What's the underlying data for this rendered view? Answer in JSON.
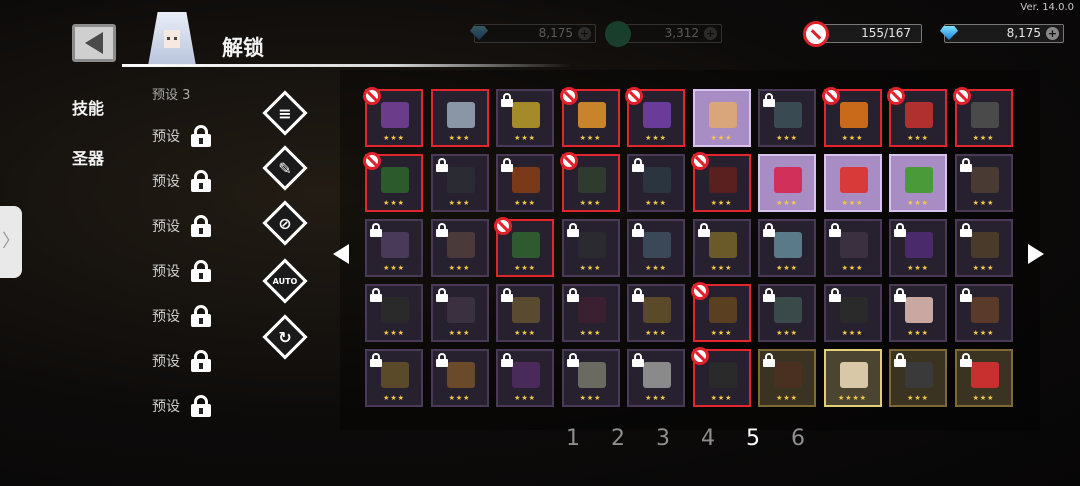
{
  "version": "Ver. 14.0.0",
  "header": {
    "title": "解锁"
  },
  "currency": [
    {
      "name": "dim-gem-currency",
      "value": "8,175",
      "dim": true,
      "icon": "gem-icon"
    },
    {
      "name": "dim-coin-currency",
      "value": "3,312",
      "dim": true,
      "icon": "coin-icon"
    },
    {
      "name": "ban-counter",
      "value": "155/167",
      "dim": false,
      "icon": "ban-icon"
    },
    {
      "name": "gem-currency",
      "value": "8,175",
      "dim": false,
      "icon": "gem-icon"
    }
  ],
  "tabs": {
    "skills": "技能",
    "relics": "圣器"
  },
  "presets": {
    "partial_label": "预设 3",
    "items": [
      "预设",
      "预设",
      "预设",
      "预设",
      "预设",
      "预设",
      "预设"
    ]
  },
  "tools": [
    "filter-search",
    "scroll-edit",
    "ban-toggle",
    "auto-ban",
    "ban-reset"
  ],
  "tool_text": {
    "auto": "AUTO"
  },
  "grid": {
    "rows": [
      [
        {
          "state": "ban",
          "style": "red",
          "stars": "★★★",
          "color": "#6a3c8a"
        },
        {
          "state": "normal",
          "style": "red",
          "stars": "★★★",
          "color": "#8a96a6"
        },
        {
          "state": "lock",
          "style": "",
          "stars": "★★★",
          "color": "#a58a2a"
        },
        {
          "state": "ban",
          "style": "red",
          "stars": "★★★",
          "color": "#c8842a"
        },
        {
          "state": "ban",
          "style": "red",
          "stars": "★★★",
          "color": "#6a3c9a"
        },
        {
          "state": "normal",
          "style": "purple",
          "stars": "★★★",
          "color": "#d9a57a"
        },
        {
          "state": "lock",
          "style": "",
          "stars": "★★★",
          "color": "#3a4a52"
        },
        {
          "state": "ban",
          "style": "red",
          "stars": "★★★",
          "color": "#c86a1a"
        },
        {
          "state": "ban",
          "style": "red",
          "stars": "★★★",
          "color": "#b02f2f"
        },
        {
          "state": "ban",
          "style": "red",
          "stars": "★★★",
          "color": "#4a4a4a"
        }
      ],
      [
        {
          "state": "ban",
          "style": "red",
          "stars": "★★★",
          "color": "#2d5a2d"
        },
        {
          "state": "lock",
          "style": "",
          "stars": "★★★",
          "color": "#2b2b33"
        },
        {
          "state": "lock",
          "style": "",
          "stars": "★★★",
          "color": "#7a3a1a"
        },
        {
          "state": "ban",
          "style": "red",
          "stars": "★★★",
          "color": "#2e3b2e"
        },
        {
          "state": "lock",
          "style": "",
          "stars": "★★★",
          "color": "#2a3540"
        },
        {
          "state": "ban",
          "style": "red",
          "stars": "★★★",
          "color": "#5a2020"
        },
        {
          "state": "normal",
          "style": "purple",
          "stars": "★★★",
          "color": "#d0305a"
        },
        {
          "state": "normal",
          "style": "purple",
          "stars": "★★★",
          "color": "#d83a3a"
        },
        {
          "state": "normal",
          "style": "purple",
          "stars": "★★★",
          "color": "#4a9a3a"
        },
        {
          "state": "lock",
          "style": "",
          "stars": "★★★",
          "color": "#4a3a34"
        }
      ],
      [
        {
          "state": "lock",
          "style": "",
          "stars": "★★★",
          "color": "#4a3a5a"
        },
        {
          "state": "lock",
          "style": "",
          "stars": "★★★",
          "color": "#4a3a3a"
        },
        {
          "state": "ban",
          "style": "red",
          "stars": "★★★",
          "color": "#2f5a2f"
        },
        {
          "state": "lock",
          "style": "",
          "stars": "★★★",
          "color": "#2a2a30"
        },
        {
          "state": "lock",
          "style": "",
          "stars": "★★★",
          "color": "#3a4858"
        },
        {
          "state": "lock",
          "style": "",
          "stars": "★★★",
          "color": "#6a5a2a"
        },
        {
          "state": "lock",
          "style": "",
          "stars": "★★★",
          "color": "#5a7a8a"
        },
        {
          "state": "lock",
          "style": "",
          "stars": "★★★",
          "color": "#3a3040"
        },
        {
          "state": "lock",
          "style": "",
          "stars": "★★★",
          "color": "#4a2a6a"
        },
        {
          "state": "lock",
          "style": "",
          "stars": "★★★",
          "color": "#4a3a2a"
        }
      ],
      [
        {
          "state": "lock",
          "style": "",
          "stars": "★★★",
          "color": "#2a2a2a"
        },
        {
          "state": "lock",
          "style": "",
          "stars": "★★★",
          "color": "#3a3040"
        },
        {
          "state": "lock",
          "style": "",
          "stars": "★★★",
          "color": "#5a4a30"
        },
        {
          "state": "lock",
          "style": "",
          "stars": "★★★",
          "color": "#3a2030"
        },
        {
          "state": "lock",
          "style": "",
          "stars": "★★★",
          "color": "#5a4a2a"
        },
        {
          "state": "ban",
          "style": "red",
          "stars": "★★★",
          "color": "#5a4020"
        },
        {
          "state": "lock",
          "style": "",
          "stars": "★★★",
          "color": "#3a4a4a"
        },
        {
          "state": "lock",
          "style": "",
          "stars": "★★★",
          "color": "#2a2a2a"
        },
        {
          "state": "lock",
          "style": "",
          "stars": "★★★",
          "color": "#c8a8a0"
        },
        {
          "state": "lock",
          "style": "",
          "stars": "★★★",
          "color": "#5a3a2a"
        }
      ],
      [
        {
          "state": "lock",
          "style": "",
          "stars": "★★★",
          "color": "#5a4a2a"
        },
        {
          "state": "lock",
          "style": "",
          "stars": "★★★",
          "color": "#6a4a2a"
        },
        {
          "state": "lock",
          "style": "",
          "stars": "★★★",
          "color": "#4a2a5a"
        },
        {
          "state": "lock",
          "style": "",
          "stars": "★★★",
          "color": "#6a6a60"
        },
        {
          "state": "lock",
          "style": "",
          "stars": "★★★",
          "color": "#8a8a8a"
        },
        {
          "state": "ban",
          "style": "red",
          "stars": "★★★",
          "color": "#2a2a2a"
        },
        {
          "state": "lock",
          "style": "gold",
          "stars": "★★★",
          "color": "#4a3020"
        },
        {
          "state": "normal",
          "style": "gold-hl",
          "stars": "★★★★",
          "color": "#d8c8a8"
        },
        {
          "state": "lock",
          "style": "gold",
          "stars": "★★★",
          "color": "#3a3a3a"
        },
        {
          "state": "lock",
          "style": "gold",
          "stars": "★★★",
          "color": "#c83030"
        }
      ]
    ]
  },
  "pagination": {
    "pages": [
      "1",
      "2",
      "3",
      "4",
      "5",
      "6"
    ],
    "active": "5"
  }
}
